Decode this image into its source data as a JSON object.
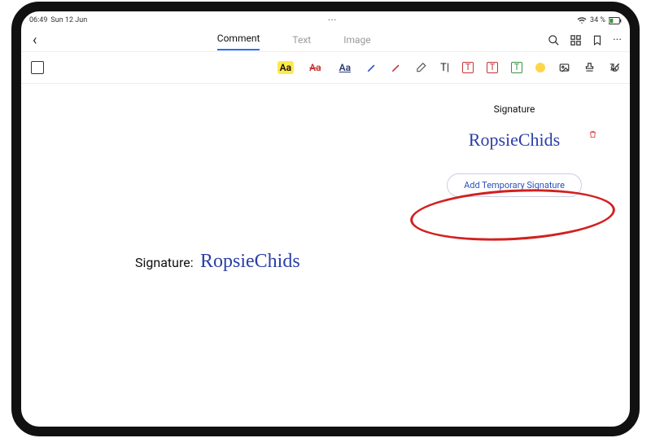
{
  "status": {
    "time": "06:49",
    "date": "Sun 12 Jun",
    "battery": "34 %"
  },
  "tabs": {
    "comment": "Comment",
    "text": "Text",
    "image": "Image"
  },
  "doc": {
    "label": "Signature:",
    "signature": "RopsieChids"
  },
  "panel": {
    "title": "Signature",
    "signature": "RopsieChids",
    "add_button": "Add Temporary Signature"
  }
}
